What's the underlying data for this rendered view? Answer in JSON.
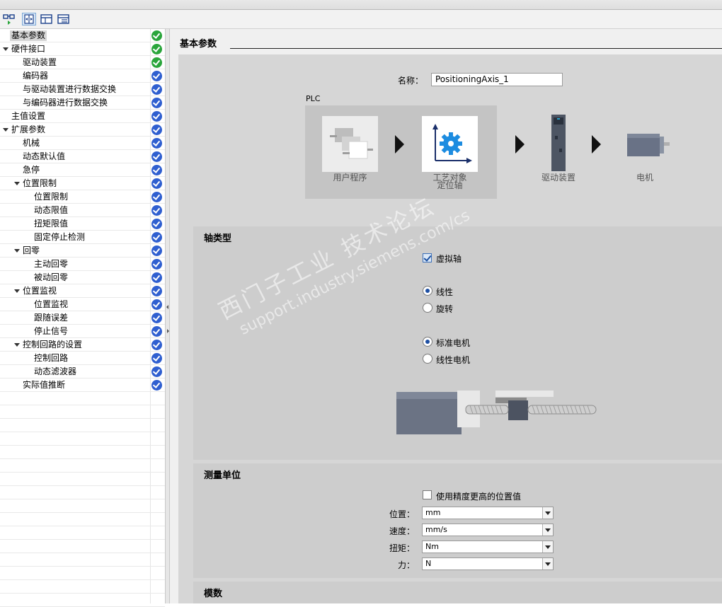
{
  "tree": {
    "items": [
      {
        "label": "基本参数",
        "selected": true,
        "expandable": false,
        "status": "ok",
        "level": 0
      },
      {
        "label": "硬件接口",
        "selected": false,
        "expandable": true,
        "status": "ok",
        "level": 0
      },
      {
        "label": "驱动装置",
        "selected": false,
        "expandable": false,
        "status": "ok",
        "level": 1
      },
      {
        "label": "编码器",
        "selected": false,
        "expandable": false,
        "status": "info",
        "level": 1
      },
      {
        "label": "与驱动装置进行数据交换",
        "selected": false,
        "expandable": false,
        "status": "info",
        "level": 1
      },
      {
        "label": "与编码器进行数据交换",
        "selected": false,
        "expandable": false,
        "status": "info",
        "level": 1
      },
      {
        "label": "主值设置",
        "selected": false,
        "expandable": false,
        "status": "info",
        "level": 0
      },
      {
        "label": "扩展参数",
        "selected": false,
        "expandable": true,
        "status": "info",
        "level": 0
      },
      {
        "label": "机械",
        "selected": false,
        "expandable": false,
        "status": "info",
        "level": 1
      },
      {
        "label": "动态默认值",
        "selected": false,
        "expandable": false,
        "status": "info",
        "level": 1
      },
      {
        "label": "急停",
        "selected": false,
        "expandable": false,
        "status": "info",
        "level": 1
      },
      {
        "label": "位置限制",
        "selected": false,
        "expandable": true,
        "status": "info",
        "level": 1
      },
      {
        "label": "位置限制",
        "selected": false,
        "expandable": false,
        "status": "info",
        "level": 2
      },
      {
        "label": "动态限值",
        "selected": false,
        "expandable": false,
        "status": "info",
        "level": 2
      },
      {
        "label": "扭矩限值",
        "selected": false,
        "expandable": false,
        "status": "info",
        "level": 2
      },
      {
        "label": "固定停止检测",
        "selected": false,
        "expandable": false,
        "status": "info",
        "level": 2
      },
      {
        "label": "回零",
        "selected": false,
        "expandable": true,
        "status": "info",
        "level": 1
      },
      {
        "label": "主动回零",
        "selected": false,
        "expandable": false,
        "status": "info",
        "level": 2
      },
      {
        "label": "被动回零",
        "selected": false,
        "expandable": false,
        "status": "info",
        "level": 2
      },
      {
        "label": "位置监视",
        "selected": false,
        "expandable": true,
        "status": "info",
        "level": 1
      },
      {
        "label": "位置监视",
        "selected": false,
        "expandable": false,
        "status": "info",
        "level": 2
      },
      {
        "label": "跟随误差",
        "selected": false,
        "expandable": false,
        "status": "info",
        "level": 2
      },
      {
        "label": "停止信号",
        "selected": false,
        "expandable": false,
        "status": "info",
        "level": 2
      },
      {
        "label": "控制回路的设置",
        "selected": false,
        "expandable": true,
        "status": "info",
        "level": 1
      },
      {
        "label": "控制回路",
        "selected": false,
        "expandable": false,
        "status": "info",
        "level": 2
      },
      {
        "label": "动态滤波器",
        "selected": false,
        "expandable": false,
        "status": "info",
        "level": 2
      },
      {
        "label": "实际值推断",
        "selected": false,
        "expandable": false,
        "status": "info",
        "level": 1
      }
    ]
  },
  "main": {
    "section_title": "基本参数",
    "name_label": "名称：",
    "name_value": "PositioningAxis_1",
    "plc_label": "PLC",
    "flow": {
      "user_program": "用户程序",
      "tech_object_line1": "工艺对象",
      "tech_object_line2": "定位轴",
      "drive": "驱动装置",
      "motor": "电机"
    }
  },
  "axis_type": {
    "title": "轴类型",
    "virtual_axis_label": "虚拟轴",
    "virtual_axis_checked": true,
    "linear_label": "线性",
    "rotary_label": "旋转",
    "motion_selected": "线性",
    "std_motor_label": "标准电机",
    "linear_motor_label": "线性电机",
    "motor_selected": "标准电机"
  },
  "units": {
    "title": "测量单位",
    "high_precision_label": "使用精度更高的位置值",
    "high_precision_checked": false,
    "position_label": "位置：",
    "position_value": "mm",
    "velocity_label": "速度：",
    "velocity_value": "mm/s",
    "torque_label": "扭矩：",
    "torque_value": "Nm",
    "force_label": "力：",
    "force_value": "N"
  },
  "modulo": {
    "title": "模数"
  },
  "watermark": {
    "line1": "西门子工业 技术论坛",
    "line2": "support.industry.siemens.com/cs"
  },
  "colors": {
    "status_ok": "#2aa53b",
    "status_info": "#2f5fd0",
    "selected_bg": "#d6d6d6"
  }
}
